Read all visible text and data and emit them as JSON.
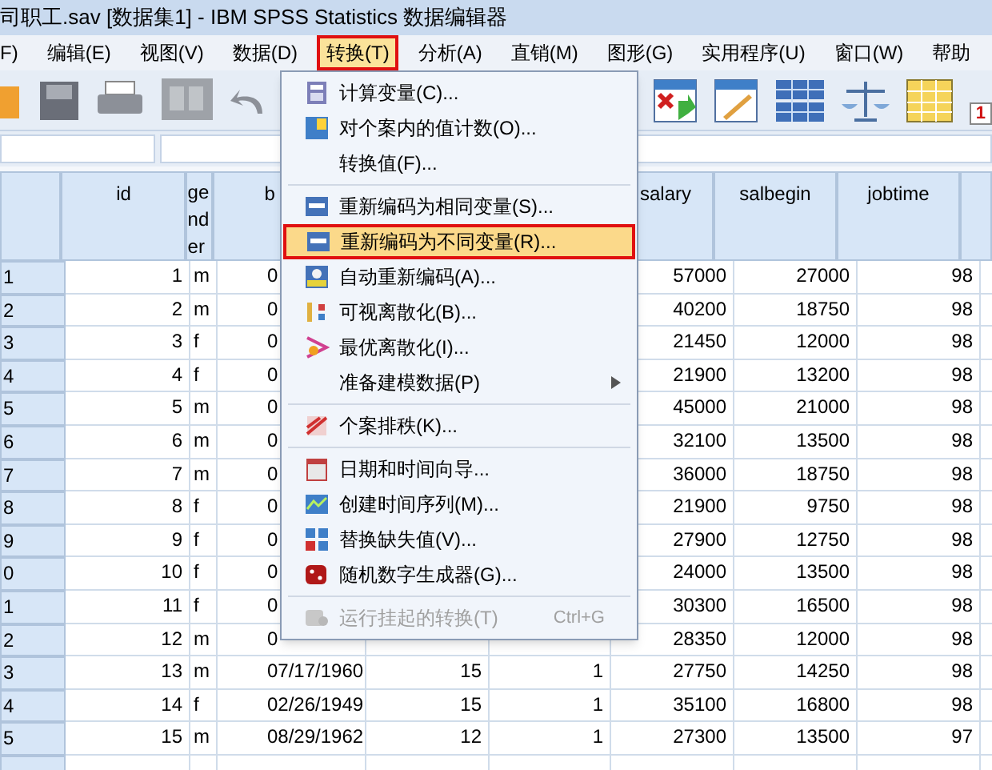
{
  "window": {
    "title": "司职工.sav [数据集1] - IBM SPSS Statistics 数据编辑器"
  },
  "menubar": [
    {
      "label": "F)",
      "selected": false
    },
    {
      "label": "编辑(E)",
      "selected": false
    },
    {
      "label": "视图(V)",
      "selected": false
    },
    {
      "label": "数据(D)",
      "selected": false
    },
    {
      "label": "转换(T)",
      "selected": true
    },
    {
      "label": "分析(A)",
      "selected": false
    },
    {
      "label": "直销(M)",
      "selected": false
    },
    {
      "label": "图形(G)",
      "selected": false
    },
    {
      "label": "实用程序(U)",
      "selected": false
    },
    {
      "label": "窗口(W)",
      "selected": false
    },
    {
      "label": "帮助",
      "selected": false
    }
  ],
  "toolbar": {
    "badge": "1"
  },
  "menu": [
    {
      "kind": "item",
      "label": "计算变量(C)...",
      "selected": false,
      "disabled": false
    },
    {
      "kind": "item",
      "label": "对个案内的值计数(O)...",
      "selected": false,
      "disabled": false
    },
    {
      "kind": "item",
      "label": "转换值(F)...",
      "selected": false,
      "disabled": false
    },
    {
      "kind": "separator"
    },
    {
      "kind": "item",
      "label": "重新编码为相同变量(S)...",
      "selected": false,
      "disabled": false
    },
    {
      "kind": "item",
      "label": "重新编码为不同变量(R)...",
      "selected": true,
      "disabled": false
    },
    {
      "kind": "item",
      "label": "自动重新编码(A)...",
      "selected": false,
      "disabled": false
    },
    {
      "kind": "item",
      "label": "可视离散化(B)...",
      "selected": false,
      "disabled": false
    },
    {
      "kind": "item",
      "label": "最优离散化(I)...",
      "selected": false,
      "disabled": false
    },
    {
      "kind": "submenu",
      "label": "准备建模数据(P)",
      "selected": false,
      "disabled": false
    },
    {
      "kind": "separator"
    },
    {
      "kind": "item",
      "label": "个案排秩(K)...",
      "selected": false,
      "disabled": false
    },
    {
      "kind": "separator"
    },
    {
      "kind": "item",
      "label": "日期和时间向导...",
      "selected": false,
      "disabled": false
    },
    {
      "kind": "item",
      "label": "创建时间序列(M)...",
      "selected": false,
      "disabled": false
    },
    {
      "kind": "item",
      "label": "替换缺失值(V)...",
      "selected": false,
      "disabled": false
    },
    {
      "kind": "item",
      "label": "随机数字生成器(G)...",
      "selected": false,
      "disabled": false
    },
    {
      "kind": "separator"
    },
    {
      "kind": "item",
      "label": "运行挂起的转换(T)",
      "shortcut": "Ctrl+G",
      "selected": false,
      "disabled": true
    }
  ],
  "table": {
    "columns": [
      "id",
      "gender",
      "b",
      "salary",
      "salbegin",
      "jobtime"
    ],
    "rows": [
      {
        "n": "1",
        "id": "1",
        "gender": "m",
        "bdate": "0",
        "salary": "57000",
        "salbegin": "27000",
        "jobtime": "98"
      },
      {
        "n": "2",
        "id": "2",
        "gender": "m",
        "bdate": "0",
        "salary": "40200",
        "salbegin": "18750",
        "jobtime": "98"
      },
      {
        "n": "3",
        "id": "3",
        "gender": "f",
        "bdate": "0",
        "salary": "21450",
        "salbegin": "12000",
        "jobtime": "98"
      },
      {
        "n": "4",
        "id": "4",
        "gender": "f",
        "bdate": "0",
        "salary": "21900",
        "salbegin": "13200",
        "jobtime": "98"
      },
      {
        "n": "5",
        "id": "5",
        "gender": "m",
        "bdate": "0",
        "salary": "45000",
        "salbegin": "21000",
        "jobtime": "98"
      },
      {
        "n": "6",
        "id": "6",
        "gender": "m",
        "bdate": "0",
        "salary": "32100",
        "salbegin": "13500",
        "jobtime": "98"
      },
      {
        "n": "7",
        "id": "7",
        "gender": "m",
        "bdate": "0",
        "salary": "36000",
        "salbegin": "18750",
        "jobtime": "98"
      },
      {
        "n": "8",
        "id": "8",
        "gender": "f",
        "bdate": "0",
        "salary": "21900",
        "salbegin": "9750",
        "jobtime": "98"
      },
      {
        "n": "9",
        "id": "9",
        "gender": "f",
        "bdate": "0",
        "salary": "27900",
        "salbegin": "12750",
        "jobtime": "98"
      },
      {
        "n": "0",
        "id": "10",
        "gender": "f",
        "bdate": "0",
        "salary": "24000",
        "salbegin": "13500",
        "jobtime": "98"
      },
      {
        "n": "1",
        "id": "11",
        "gender": "f",
        "bdate": "0",
        "salary": "30300",
        "salbegin": "16500",
        "jobtime": "98"
      },
      {
        "n": "2",
        "id": "12",
        "gender": "m",
        "bdate": "0",
        "salary": "28350",
        "salbegin": "12000",
        "jobtime": "98"
      },
      {
        "n": "3",
        "id": "13",
        "gender": "m",
        "bdate": "07/17/1960",
        "educ": "15",
        "col5": "1",
        "salary": "27750",
        "salbegin": "14250",
        "jobtime": "98"
      },
      {
        "n": "4",
        "id": "14",
        "gender": "f",
        "bdate": "02/26/1949",
        "educ": "15",
        "col5": "1",
        "salary": "35100",
        "salbegin": "16800",
        "jobtime": "98"
      },
      {
        "n": "5",
        "id": "15",
        "gender": "m",
        "bdate": "08/29/1962",
        "educ": "12",
        "col5": "1",
        "salary": "27300",
        "salbegin": "13500",
        "jobtime": "97"
      }
    ]
  }
}
